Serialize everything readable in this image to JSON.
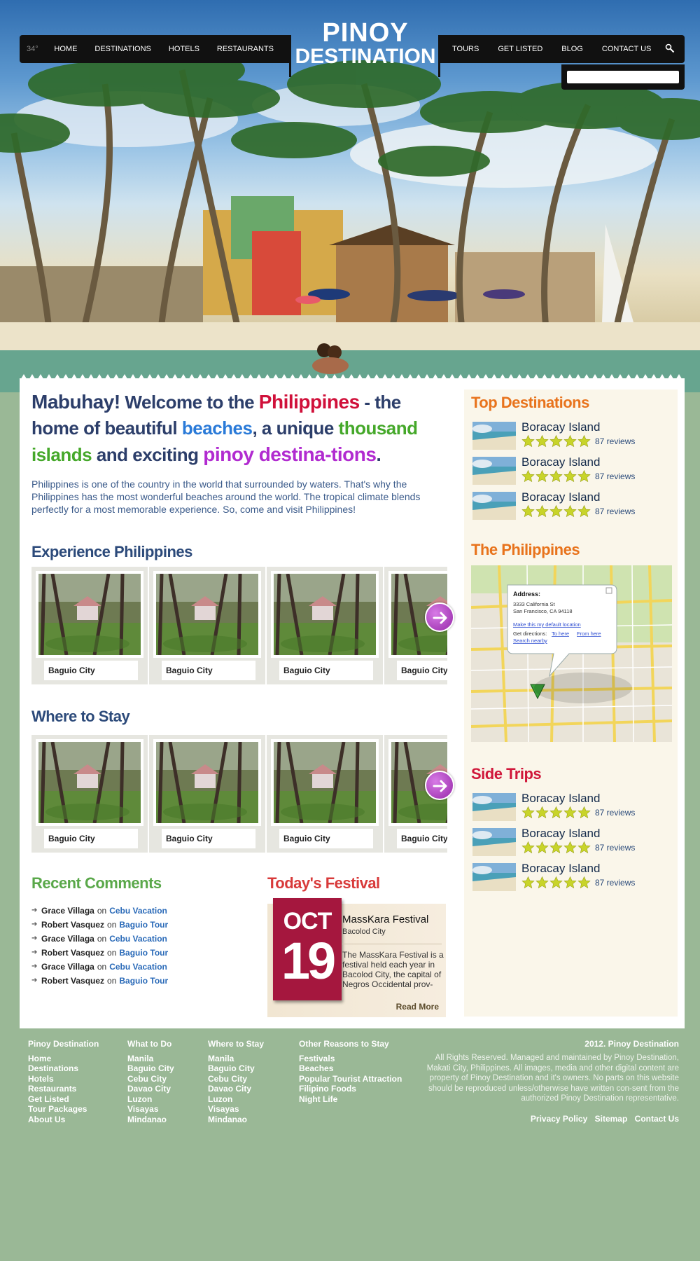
{
  "nav": {
    "temperature": "34°",
    "left_items": [
      "HOME",
      "DESTINATIONS",
      "HOTELS",
      "RESTAURANTS"
    ],
    "right_items": [
      "TOURS",
      "GET LISTED",
      "BLOG",
      "CONTACT US"
    ],
    "search_placeholder": ""
  },
  "logo": {
    "line1": "PINOY",
    "line2": "DESTINATION"
  },
  "intro": {
    "p1": "Mabuhay!",
    "p2": " Welcome to the ",
    "p3": "Philippines",
    "p4": " - the home of beautiful ",
    "p5": "beaches",
    "p6": ", a unique ",
    "p7": "thousand islands",
    "p8": " and exciting ",
    "p9": "pinoy destina-tions",
    "p10": ".",
    "description": "Philippines is one of the country in the world that surrounded by waters. That's why the Philippines has the most wonderful beaches around the world. The tropical climate blends perfectly for a most memorable experience. So, come and visit Philippines!"
  },
  "experience": {
    "title": "Experience Philippines",
    "items": [
      "Baguio City",
      "Baguio City",
      "Baguio City",
      "Baguio City"
    ]
  },
  "stay": {
    "title": "Where to Stay",
    "items": [
      "Baguio City",
      "Baguio City",
      "Baguio City",
      "Baguio City"
    ]
  },
  "comments": {
    "title": "Recent Comments",
    "items": [
      {
        "name": "Grace Villaga",
        "on": "on",
        "post": "Cebu Vacation"
      },
      {
        "name": "Robert Vasquez",
        "on": "on",
        "post": "Baguio Tour"
      },
      {
        "name": "Grace Villaga",
        "on": "on",
        "post": "Cebu Vacation"
      },
      {
        "name": "Robert Vasquez",
        "on": "on",
        "post": "Baguio Tour"
      },
      {
        "name": "Grace Villaga",
        "on": "on",
        "post": "Cebu Vacation"
      },
      {
        "name": "Robert Vasquez",
        "on": "on",
        "post": "Baguio Tour"
      }
    ]
  },
  "festival": {
    "title": "Today's Festival",
    "month": "OCT",
    "day": "19",
    "name": "MassKara Festival",
    "location": "Bacolod City",
    "description": "The MassKara Festival is a festival held each year in Bacolod City, the capital of Negros Occidental prov-",
    "read_more": "Read More"
  },
  "sidebar": {
    "top_title": "Top Destinations",
    "top_items": [
      {
        "name": "Boracay Island",
        "reviews": "87 reviews",
        "rating": 5
      },
      {
        "name": "Boracay Island",
        "reviews": "87 reviews",
        "rating": 5
      },
      {
        "name": "Boracay Island",
        "reviews": "87 reviews",
        "rating": 5
      }
    ],
    "map_title": "The Philippines",
    "map": {
      "address_label": "Address:",
      "address_line1": "3333 California St",
      "address_line2": "San Francisco, CA 94118",
      "default_link": "Make this my default location",
      "directions_label": "Get directions:",
      "to_here": "To here",
      "from_here": "From here",
      "search_nearby": "Search nearby"
    },
    "side_title": "Side Trips",
    "side_items": [
      {
        "name": "Boracay Island",
        "reviews": "87 reviews",
        "rating": 5
      },
      {
        "name": "Boracay Island",
        "reviews": "87 reviews",
        "rating": 5
      },
      {
        "name": "Boracay Island",
        "reviews": "87 reviews",
        "rating": 5
      }
    ]
  },
  "footer": {
    "columns": [
      {
        "heading": "Pinoy Destination",
        "links": [
          "Home",
          "Destinations",
          "Hotels",
          "Restaurants",
          "Get Listed",
          "Tour Packages",
          "About Us"
        ]
      },
      {
        "heading": "What to Do",
        "links": [
          "Manila",
          "Baguio City",
          "Cebu City",
          "Davao City",
          "Luzon",
          "Visayas",
          "Mindanao"
        ]
      },
      {
        "heading": "Where to Stay",
        "links": [
          "Manila",
          "Baguio City",
          "Cebu City",
          "Davao City",
          "Luzon",
          "Visayas",
          "Mindanao"
        ]
      },
      {
        "heading": "Other Reasons to Stay",
        "links": [
          "Festivals",
          "Beaches",
          "Popular Tourist Attraction",
          "Filipino Foods",
          "Night Life"
        ]
      }
    ],
    "copyright_title": "2012. Pinoy Destination",
    "copyright_text": "All Rights Reserved. Managed and maintained by Pinoy Destination, Makati City, Philippines. All images, media and other digital content are property of Pinoy Destination and it's owners. No parts on this website should be reproduced unless/otherwise have written con-sent from the authorized Pinoy Destination representative.",
    "links": [
      "Privacy Policy",
      "Sitemap",
      "Contact Us"
    ]
  },
  "colors": {
    "accent_orange": "#e8731c",
    "accent_red": "#d83a3a",
    "accent_purple": "#b12bd0",
    "festival_red": "#a5173e",
    "page_background": "#9ab896"
  }
}
